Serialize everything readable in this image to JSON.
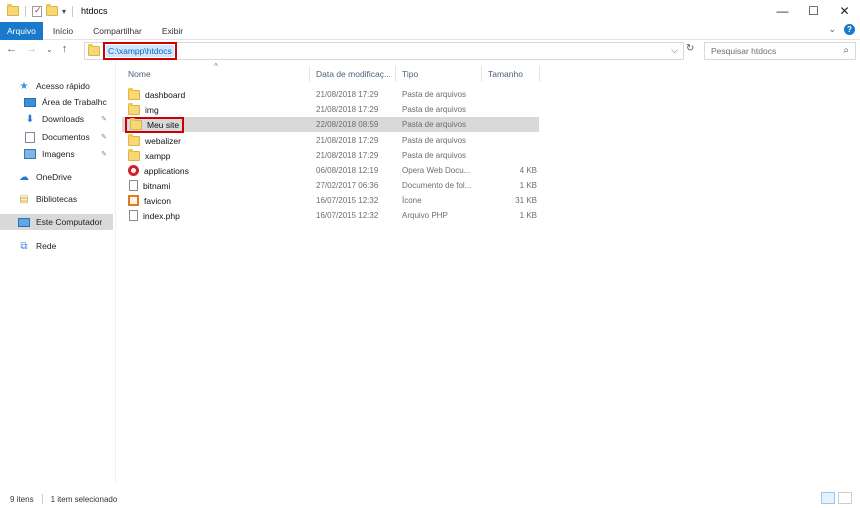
{
  "window": {
    "title": "htdocs",
    "controls": {
      "minimize": "—",
      "maximize": "☐",
      "close": "✕"
    }
  },
  "ribbon": {
    "tabs": [
      "Arquivo",
      "Início",
      "Compartilhar",
      "Exibir"
    ],
    "expand_icon": "chevron-down-icon",
    "help_icon": "?"
  },
  "address": {
    "path": "C:\\xampp\\htdocs",
    "dropdown_icon": "⌵",
    "refresh_icon": "↻"
  },
  "search": {
    "placeholder": "Pesquisar htdocs",
    "icon": "⌕"
  },
  "nav_buttons": {
    "back": "←",
    "forward": "→",
    "recent": "⌄",
    "up": "↑"
  },
  "navpane": {
    "quick_access": "Acesso rápido",
    "items": [
      {
        "label": "Área de Trabalhc",
        "icon": "desktop-icon",
        "pinned": true
      },
      {
        "label": "Downloads",
        "icon": "download-icon",
        "pinned": true
      },
      {
        "label": "Documentos",
        "icon": "documents-icon",
        "pinned": true
      },
      {
        "label": "Imagens",
        "icon": "pictures-icon",
        "pinned": true
      }
    ],
    "onedrive": "OneDrive",
    "libraries": "Bibliotecas",
    "this_pc": "Este Computador",
    "network": "Rede",
    "pin_glyph": "📌"
  },
  "columns": {
    "name": "Nome",
    "date": "Data de modificaç...",
    "type": "Tipo",
    "size": "Tamanho"
  },
  "files": [
    {
      "name": "dashboard",
      "date": "21/08/2018 17:29",
      "type": "Pasta de arquivos",
      "size": "",
      "icon": "folder-icon"
    },
    {
      "name": "img",
      "date": "21/08/2018 17:29",
      "type": "Pasta de arquivos",
      "size": "",
      "icon": "folder-icon"
    },
    {
      "name": "Meu site",
      "date": "22/08/2018 08:59",
      "type": "Pasta de arquivos",
      "size": "",
      "icon": "folder-icon",
      "selected": true
    },
    {
      "name": "webalizer",
      "date": "21/08/2018 17:29",
      "type": "Pasta de arquivos",
      "size": "",
      "icon": "folder-icon"
    },
    {
      "name": "xampp",
      "date": "21/08/2018 17:29",
      "type": "Pasta de arquivos",
      "size": "",
      "icon": "folder-icon"
    },
    {
      "name": "applications",
      "date": "06/08/2018 12:19",
      "type": "Opera Web Docu...",
      "size": "4 KB",
      "icon": "opera-icon"
    },
    {
      "name": "bitnami",
      "date": "27/02/2017 06:36",
      "type": "Documento de fol...",
      "size": "1 KB",
      "icon": "file-icon"
    },
    {
      "name": "favicon",
      "date": "16/07/2015 12:32",
      "type": "Ícone",
      "size": "31 KB",
      "icon": "favicon-icon"
    },
    {
      "name": "index.php",
      "date": "16/07/2015 12:32",
      "type": "Arquivo PHP",
      "size": "1 KB",
      "icon": "file-icon"
    }
  ],
  "status": {
    "count": "9 itens",
    "selected": "1 item selecionado"
  },
  "colors": {
    "accent": "#1979ca",
    "selection": "#d9d9d9",
    "highlight_box": "#cc0000"
  }
}
